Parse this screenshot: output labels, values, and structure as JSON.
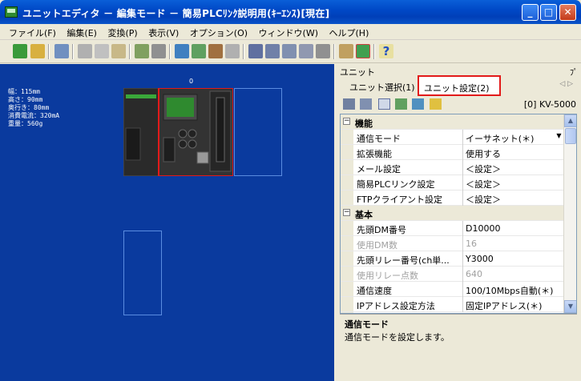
{
  "window": {
    "title": "ユニットエディタ － 編集モード － 簡易PLCﾘﾝｸ説明用(ｷｰｴﾝｽ)[現在]",
    "minimize": "_",
    "maximize": "□",
    "close": "✕"
  },
  "menu": [
    "ファイル(F)",
    "編集(E)",
    "変換(P)",
    "表示(V)",
    "オプション(O)",
    "ウィンドウ(W)",
    "ヘルプ(H)"
  ],
  "canvas": {
    "slot_index": "0",
    "info": [
      "幅：115mm",
      "高さ：90mm",
      "奥行き：80mm",
      "消費電流：320mA",
      "重量：560g"
    ]
  },
  "panel": {
    "header": "ユニット",
    "pin": "ﾌﾟ",
    "tabs": [
      "ユニット選択(1)",
      "ユニット設定(2)"
    ],
    "tab_nav": "◁ ▷",
    "unit_label": "[0] KV-5000"
  },
  "grid": {
    "categories": [
      {
        "label": "機能",
        "rows": [
          {
            "key": "通信モード",
            "value": "イーサネット(＊)",
            "disabled": false,
            "dropdown": true
          },
          {
            "key": "拡張機能",
            "value": "使用する",
            "disabled": false
          },
          {
            "key": "メール設定",
            "value": "＜設定＞",
            "disabled": false
          },
          {
            "key": "簡易PLCリンク設定",
            "value": "＜設定＞",
            "disabled": false
          },
          {
            "key": "FTPクライアント設定",
            "value": "＜設定＞",
            "disabled": false
          }
        ]
      },
      {
        "label": "基本",
        "rows": [
          {
            "key": "先頭DM番号",
            "value": "D10000",
            "disabled": false
          },
          {
            "key": "使用DM数",
            "value": "16",
            "disabled": true
          },
          {
            "key": "先頭リレー番号(ch単...",
            "value": "Y3000",
            "disabled": false
          },
          {
            "key": "使用リレー点数",
            "value": "640",
            "disabled": true
          },
          {
            "key": "通信速度",
            "value": "100/10Mbps自動(＊)",
            "disabled": false
          },
          {
            "key": "IPアドレス設定方法",
            "value": "固定IPアドレス(＊)",
            "disabled": false
          }
        ]
      }
    ]
  },
  "description": {
    "title": "通信モード",
    "text": "通信モードを設定します。"
  },
  "colors": {
    "canvas_bg": "#0a3a9e",
    "highlight": "#e21a1a",
    "titlebar": "#0049c7"
  }
}
